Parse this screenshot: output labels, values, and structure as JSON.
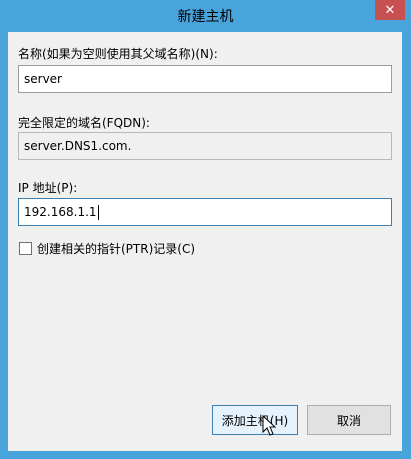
{
  "window": {
    "title": "新建主机",
    "close_icon": "✕"
  },
  "form": {
    "name_label": "名称(如果为空则使用其父域名称)(N):",
    "name_value": "server",
    "fqdn_label": "完全限定的域名(FQDN):",
    "fqdn_value": "server.DNS1.com.",
    "ip_label": "IP 地址(P):",
    "ip_value": "192.168.1.1",
    "ptr_checkbox_label": "创建相关的指针(PTR)记录(C)",
    "ptr_checked": false
  },
  "buttons": {
    "add_host": "添加主机(H)",
    "cancel": "取消"
  },
  "colors": {
    "titlebar": "#4aa4dc",
    "client": "#f0f0f0",
    "close_button": "#c75050",
    "focus_border": "#3c7fb1"
  }
}
